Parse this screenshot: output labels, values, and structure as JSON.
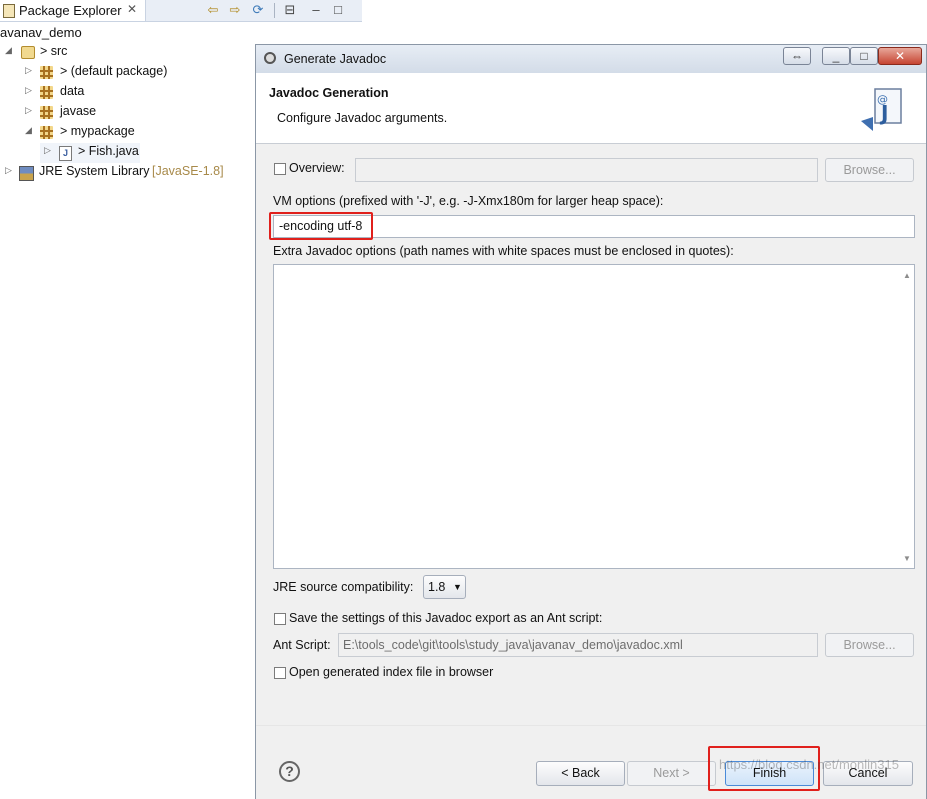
{
  "package_explorer": {
    "tab_label": "Package Explorer",
    "project_label": "avanav_demo",
    "tree": {
      "src": "> src",
      "default_package": "> (default package)",
      "data": "data",
      "javase": "javase",
      "mypackage": "> mypackage",
      "fish": "> Fish.java",
      "jre_name": "JRE System Library",
      "jre_version": "[JavaSE-1.8]"
    }
  },
  "dialog": {
    "title": "Generate Javadoc",
    "heading": "Javadoc Generation",
    "message": "Configure Javadoc arguments.",
    "overview_label": "Overview:",
    "overview_value": "",
    "browse_label": "Browse...",
    "vm_options_label": "VM options (prefixed with '-J', e.g. -J-Xmx180m for larger heap space):",
    "vm_options_value": "-encoding utf-8",
    "extra_options_label": "Extra Javadoc options (path names with white spaces must be enclosed in quotes):",
    "extra_options_value": "",
    "jre_compat_label": "JRE source compatibility:",
    "jre_compat_value": "1.8",
    "save_ant_label": "Save the settings of this Javadoc export as an Ant script:",
    "ant_script_label": "Ant Script:",
    "ant_script_value": "E:\\tools_code\\git\\tools\\study_java\\javanav_demo\\javadoc.xml",
    "open_index_label": "Open generated index file in browser",
    "back_label": "< Back",
    "next_label": "Next >",
    "finish_label": "Finish",
    "cancel_label": "Cancel",
    "help_icon": "?",
    "watermark": "https://blog.csdn.net/monlin315"
  },
  "colors": {
    "highlight": "#e0201c",
    "title_bar": "#dfe6ef"
  }
}
